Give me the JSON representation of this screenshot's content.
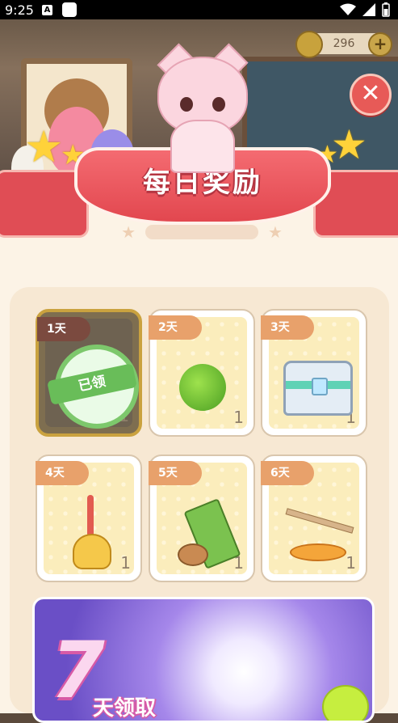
{
  "status_bar": {
    "time": "9:25",
    "notif_icon": "A"
  },
  "currency": {
    "amount": "296",
    "add_label": "+"
  },
  "close_label": "✕",
  "title": "每日奖励",
  "rewards": [
    {
      "day": "1天",
      "qty": "1",
      "claimed": true,
      "stamp_label": "已领"
    },
    {
      "day": "2天",
      "qty": "1"
    },
    {
      "day": "3天",
      "qty": "1"
    },
    {
      "day": "4天",
      "qty": "1"
    },
    {
      "day": "5天",
      "qty": "1"
    },
    {
      "day": "6天",
      "qty": "1"
    }
  ],
  "day7": {
    "number": "7",
    "label": "天领取"
  },
  "colors": {
    "ribbon": "#e2474f",
    "panel": "#fcf3e6",
    "day_tag": "#e8a16b",
    "claimed_stamp": "#69bd59"
  }
}
